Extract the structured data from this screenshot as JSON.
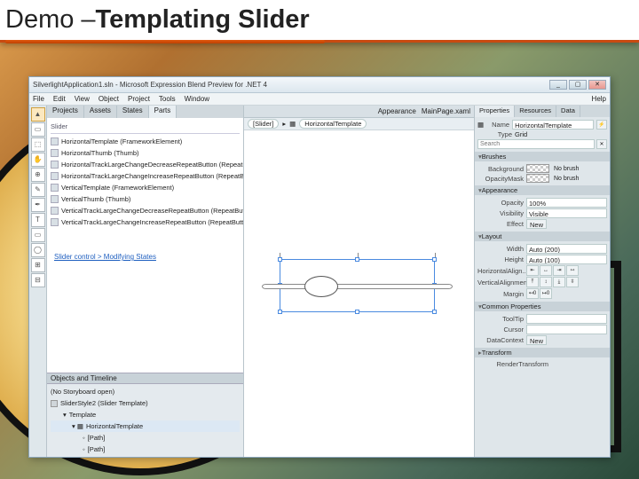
{
  "slide": {
    "title_pre": "Demo – ",
    "title_bold": "Templating Slider"
  },
  "window": {
    "title": "SilverlightApplication1.sln - Microsoft Expression Blend Preview for .NET 4",
    "min": "_",
    "max": "▢",
    "close": "✕"
  },
  "menu": [
    "File",
    "Edit",
    "View",
    "Object",
    "Project",
    "Tools",
    "Window",
    "Help"
  ],
  "left_tabs": [
    "Projects",
    "Assets",
    "States",
    "Parts",
    "Assets"
  ],
  "ctr_tabs": [
    "Appearance",
    "MainPage.xaml"
  ],
  "parts": {
    "header": "Slider",
    "items": [
      "HorizontalTemplate (FrameworkElement)",
      "HorizontalThumb (Thumb)",
      "HorizontalTrackLargeChangeDecreaseRepeatButton (RepeatButton)",
      "HorizontalTrackLargeChangeIncreaseRepeatButton (RepeatButton)",
      "VerticalTemplate (FrameworkElement)",
      "VerticalThumb (Thumb)",
      "VerticalTrackLargeChangeDecreaseRepeatButton (RepeatButton)",
      "VerticalTrackLargeChangeIncreaseRepeatButton (RepeatButton)"
    ],
    "states_link": "Slider control > Modifying States"
  },
  "timeline": {
    "header": "Objects and Timeline",
    "noStory": "(No Storyboard open)",
    "root": "SliderStyle2 (Slider Template)",
    "template": "Template",
    "node": "HorizontalTemplate",
    "children": [
      "[Path]",
      "[Path]"
    ]
  },
  "crumbs": {
    "a": "[Slider]",
    "b": "HorizontalTemplate"
  },
  "right_tabs": [
    "Properties",
    "Resources",
    "Data"
  ],
  "props": {
    "name_lbl": "Name",
    "name_val": "HorizontalTemplate",
    "type_lbl": "Type",
    "type_val": "Grid",
    "search_ph": "Search",
    "brushes_h": "Brushes",
    "bg_lbl": "Background",
    "bg_val": "No brush",
    "om_lbl": "OpacityMask",
    "om_val": "No brush",
    "appearance_h": "Appearance",
    "opacity_lbl": "Opacity",
    "opacity_val": "100%",
    "visibility_lbl": "Visibility",
    "visibility_val": "Visible",
    "effect_lbl": "Effect",
    "new_btn": "New",
    "layout_h": "Layout",
    "width_lbl": "Width",
    "width_val": "Auto (200)",
    "height_lbl": "Height",
    "height_val": "Auto (100)",
    "ha_lbl": "HorizontalAlign...",
    "va_lbl": "VerticalAlignment",
    "margin_lbl": "Margin",
    "common_h": "Common Properties",
    "tooltip_lbl": "ToolTip",
    "cursor_lbl": "Cursor",
    "datactx_lbl": "DataContext",
    "transform_h": "Transform",
    "render_lbl": "RenderTransform"
  },
  "tools": [
    "▲",
    "▭",
    "⬚",
    "✋",
    "⊕",
    "✎",
    "✒",
    "T",
    "▭",
    "◯",
    "⊞",
    "⊟"
  ]
}
